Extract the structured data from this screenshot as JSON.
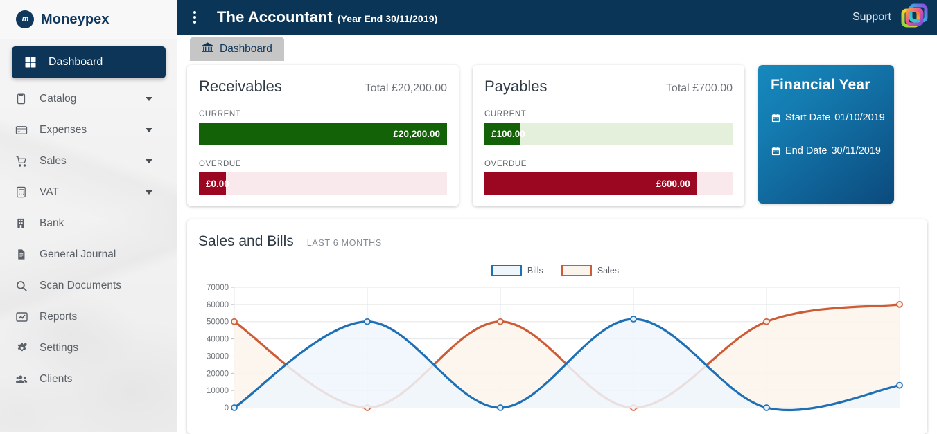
{
  "brand": {
    "logo_icon": "moneypex-circle-logo",
    "mark_text": "m",
    "name": "Moneypex"
  },
  "sidebar": {
    "items": [
      {
        "label": "Dashboard",
        "icon": "grid-dashboard-icon",
        "active": true,
        "caret": false
      },
      {
        "label": "Catalog",
        "icon": "clipboard-icon",
        "active": false,
        "caret": true
      },
      {
        "label": "Expenses",
        "icon": "credit-card-icon",
        "active": false,
        "caret": true
      },
      {
        "label": "Sales",
        "icon": "shopping-cart-icon",
        "active": false,
        "caret": true
      },
      {
        "label": "VAT",
        "icon": "calculator-icon",
        "active": false,
        "caret": true
      },
      {
        "label": "Bank",
        "icon": "bank-building-icon",
        "active": false,
        "caret": false
      },
      {
        "label": "General Journal",
        "icon": "document-lines-icon",
        "active": false,
        "caret": false
      },
      {
        "label": "Scan Documents",
        "icon": "search-icon",
        "active": false,
        "caret": false
      },
      {
        "label": "Reports",
        "icon": "line-chart-icon",
        "active": false,
        "caret": false
      },
      {
        "label": "Settings",
        "icon": "gears-icon",
        "active": false,
        "caret": false
      },
      {
        "label": "Clients",
        "icon": "users-group-icon",
        "active": false,
        "caret": false
      }
    ]
  },
  "topbar": {
    "menu_icon": "vertical-kebab-icon",
    "title": "The Accountant",
    "subtitle": "(Year End 30/11/2019)",
    "support_label": "Support",
    "logo_icon": "moneypex-gradient-squares-logo"
  },
  "breadcrumb": {
    "icon": "bank-institution-icon",
    "label": "Dashboard"
  },
  "cards": [
    {
      "title": "Receivables",
      "total_label": "Total £20,200.00",
      "rows": [
        {
          "label": "CURRENT",
          "value": "£20,200.00",
          "percent": 100,
          "color": "#136207",
          "track": "#e4efdc",
          "align": "right"
        },
        {
          "label": "OVERDUE",
          "value": "£0.00",
          "percent": 11,
          "color": "#9b0620",
          "track": "#fae9ec",
          "align": "left"
        }
      ]
    },
    {
      "title": "Payables",
      "total_label": "Total £700.00",
      "rows": [
        {
          "label": "CURRENT",
          "value": "£100.00",
          "percent": 14.3,
          "color": "#136207",
          "track": "#e4efdc",
          "align": "left"
        },
        {
          "label": "OVERDUE",
          "value": "£600.00",
          "percent": 85.7,
          "color": "#9b0620",
          "track": "#fae9ec",
          "align": "right"
        }
      ]
    }
  ],
  "financial_year": {
    "title": "Financial Year",
    "start_icon": "calendar-icon",
    "start_label": "Start Date",
    "start_value": "01/10/2019",
    "end_icon": "calendar-icon",
    "end_label": "End Date",
    "end_value": "30/11/2019"
  },
  "chart_panel": {
    "title": "Sales and Bills",
    "subtitle": "LAST 6 MONTHS"
  },
  "chart_data": {
    "type": "line",
    "title": "Sales and Bills",
    "subtitle": "LAST 6 MONTHS",
    "xlabel": "",
    "ylabel": "",
    "ylim": [
      0,
      70000
    ],
    "yticks": [
      0,
      10000,
      20000,
      30000,
      40000,
      50000,
      60000,
      70000
    ],
    "ytick_labels": [
      "0",
      "10000",
      "20000",
      "30000",
      "40000",
      "50000",
      "60000",
      "70000"
    ],
    "grid": true,
    "legend_position": "top-center",
    "x": [
      1,
      2,
      3,
      4,
      5,
      6
    ],
    "series": [
      {
        "name": "Bills",
        "color": "#1f6fb5",
        "fill": "#eef6fc",
        "values": [
          0,
          50000,
          0,
          51500,
          0,
          13000
        ]
      },
      {
        "name": "Sales",
        "color": "#cd5c36",
        "fill": "#fbf4ec",
        "values": [
          50000,
          0,
          50000,
          0,
          50000,
          60000
        ]
      }
    ]
  }
}
